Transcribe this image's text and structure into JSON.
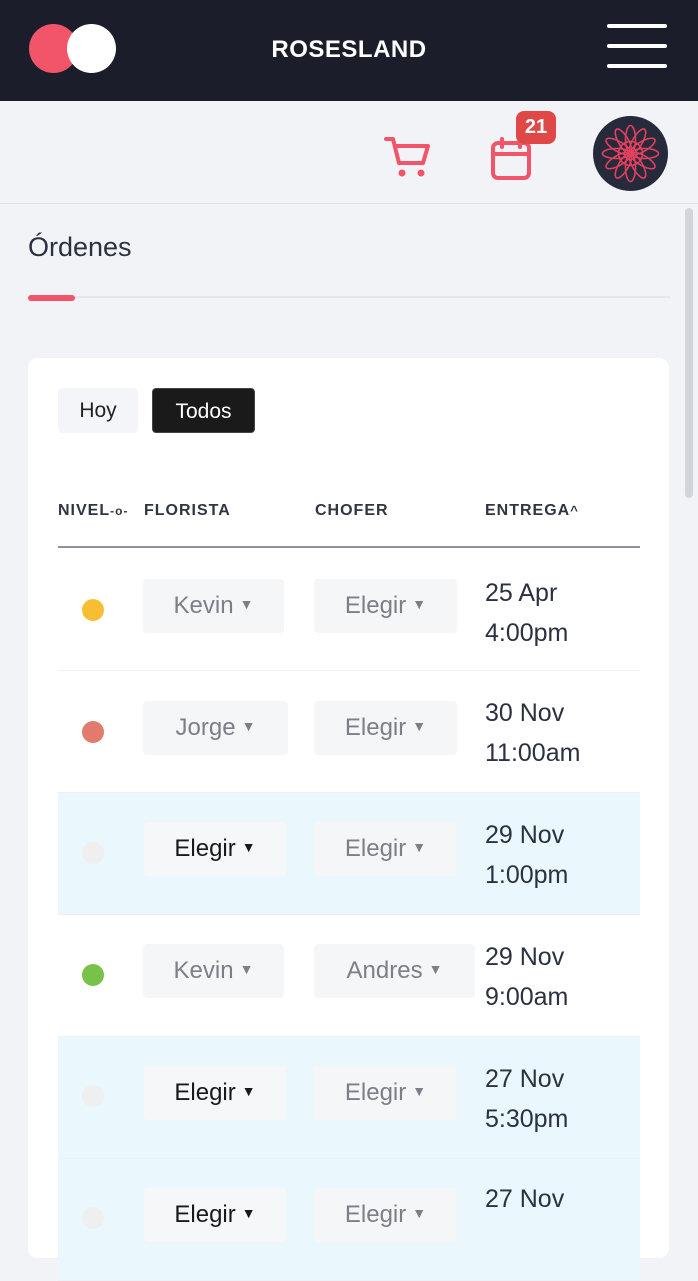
{
  "header": {
    "brand": "ROSESLAND"
  },
  "notifications": {
    "calendar_badge": "21"
  },
  "page": {
    "title": "Órdenes"
  },
  "filters": {
    "hoy": "Hoy",
    "todos": "Todos",
    "active": "Todos"
  },
  "table": {
    "headers": {
      "nivel": "NIVEL",
      "florista": "FLORISTA",
      "chofer": "CHOFER",
      "entrega": "ENTREGA"
    },
    "rows": [
      {
        "level_color": "#f7be33",
        "florista": "Kevin",
        "chofer": "Elegir",
        "date": "25 Apr",
        "time": "4:00pm"
      },
      {
        "level_color": "#e27a6d",
        "florista": "Jorge",
        "chofer": "Elegir",
        "date": "30 Nov",
        "time": "11:00am"
      },
      {
        "level_color": "#efefef",
        "florista": "Elegir",
        "chofer": "Elegir",
        "date": "29 Nov",
        "time": "1:00pm"
      },
      {
        "level_color": "#79c24a",
        "florista": "Kevin",
        "chofer": "Andres",
        "date": "29 Nov",
        "time": "9:00am"
      },
      {
        "level_color": "#efefef",
        "florista": "Elegir",
        "chofer": "Elegir",
        "date": "27 Nov",
        "time": "5:30pm"
      },
      {
        "level_color": "#efefef",
        "florista": "Elegir",
        "chofer": "Elegir",
        "date": "27 Nov",
        "time": ""
      }
    ]
  },
  "colors": {
    "brand": "#f2556a",
    "topbar": "#1b1d2b",
    "highlight_row": "#eaf7fd"
  }
}
